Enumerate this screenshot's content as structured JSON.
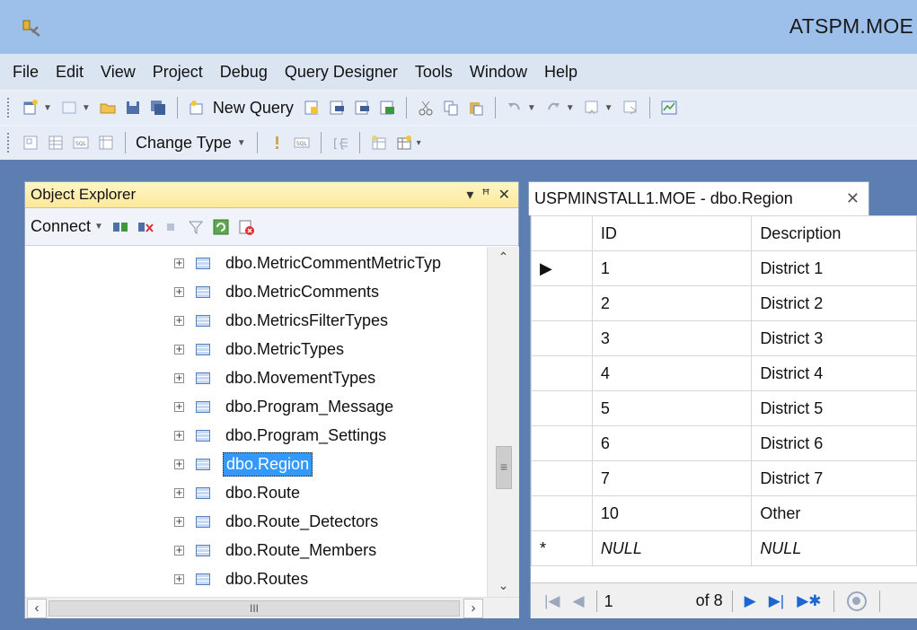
{
  "window": {
    "title": "ATSPM.MOE"
  },
  "menu": [
    "File",
    "Edit",
    "View",
    "Project",
    "Debug",
    "Query Designer",
    "Tools",
    "Window",
    "Help"
  ],
  "toolbar": {
    "new_query_label": "New Query",
    "change_type_label": "Change Type"
  },
  "object_explorer": {
    "title": "Object Explorer",
    "header_buttons": {
      "dropdown": "▾",
      "pin": "ᵖ",
      "close": "✕"
    },
    "connect_label": "Connect",
    "tree_items": [
      {
        "label": "dbo.MetricCommentMetricTyp",
        "selected": false
      },
      {
        "label": "dbo.MetricComments",
        "selected": false
      },
      {
        "label": "dbo.MetricsFilterTypes",
        "selected": false
      },
      {
        "label": "dbo.MetricTypes",
        "selected": false
      },
      {
        "label": "dbo.MovementTypes",
        "selected": false
      },
      {
        "label": "dbo.Program_Message",
        "selected": false
      },
      {
        "label": "dbo.Program_Settings",
        "selected": false
      },
      {
        "label": "dbo.Region",
        "selected": true
      },
      {
        "label": "dbo.Route",
        "selected": false
      },
      {
        "label": "dbo.Route_Detectors",
        "selected": false
      },
      {
        "label": "dbo.Route_Members",
        "selected": false
      },
      {
        "label": "dbo.Routes",
        "selected": false
      }
    ],
    "hscroll_thumb": "III"
  },
  "document_tab": {
    "label": "USPMINSTALL1.MOE - dbo.Region",
    "close": "✕"
  },
  "grid": {
    "columns": [
      "ID",
      "Description"
    ],
    "rows": [
      {
        "marker": "▶",
        "id": "1",
        "description": "District 1"
      },
      {
        "marker": "",
        "id": "2",
        "description": "District 2"
      },
      {
        "marker": "",
        "id": "3",
        "description": "District 3"
      },
      {
        "marker": "",
        "id": "4",
        "description": "District 4"
      },
      {
        "marker": "",
        "id": "5",
        "description": "District 5"
      },
      {
        "marker": "",
        "id": "6",
        "description": "District 6"
      },
      {
        "marker": "",
        "id": "7",
        "description": "District 7"
      },
      {
        "marker": "",
        "id": "10",
        "description": "Other"
      }
    ],
    "new_row": {
      "marker": "*",
      "id": "NULL",
      "description": "NULL"
    }
  },
  "navigator": {
    "current_record": "1",
    "of_label": "of 8"
  },
  "colors": {
    "selection": "#3399ff",
    "titlebar": "#9cc0ea",
    "panel_header": "#fde99a"
  }
}
